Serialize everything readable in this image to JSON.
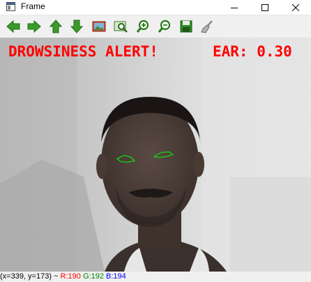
{
  "window": {
    "title": "Frame"
  },
  "toolbar": {
    "buttons": [
      {
        "icon": "arrow-left-icon"
      },
      {
        "icon": "arrow-right-icon"
      },
      {
        "icon": "arrow-up-icon"
      },
      {
        "icon": "arrow-down-icon"
      },
      {
        "icon": "image-icon"
      },
      {
        "icon": "zoom-region-icon"
      },
      {
        "icon": "zoom-in-icon"
      },
      {
        "icon": "zoom-out-icon"
      },
      {
        "icon": "save-icon"
      },
      {
        "icon": "brush-icon"
      }
    ]
  },
  "video": {
    "alert_text": "DROWSINESS ALERT!",
    "ear_text": "EAR: 0.30",
    "overlay_color": "#ff0000",
    "eye_contour_color": "#00ff00"
  },
  "status": {
    "coords": "(x=339, y=173) ~",
    "r": "R:190",
    "g": "G:192",
    "b": "B:194",
    "r_color": "#ff0000",
    "g_color": "#008000",
    "b_color": "#0000ff"
  }
}
